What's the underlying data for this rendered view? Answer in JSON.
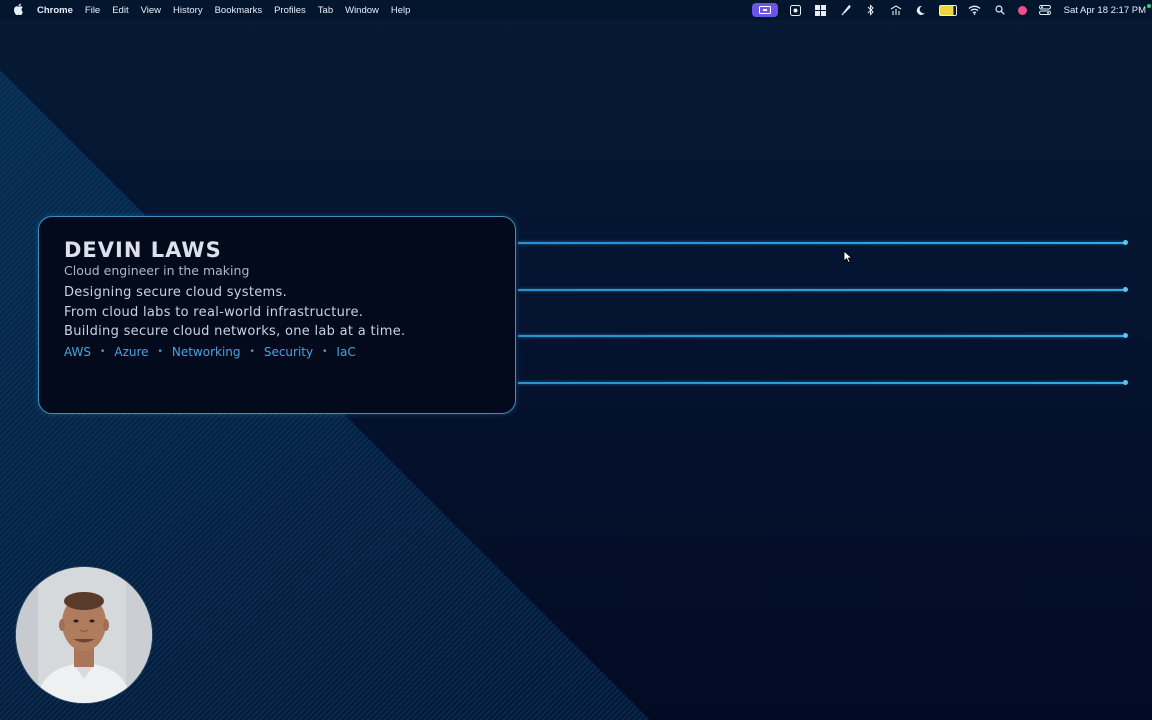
{
  "menubar": {
    "app_name": "Chrome",
    "menus": [
      "File",
      "Edit",
      "View",
      "History",
      "Bookmarks",
      "Profiles",
      "Tab",
      "Window",
      "Help"
    ],
    "clock": "Sat Apr 18  2:17 PM"
  },
  "status_icons": [
    "screen-share-icon",
    "screenshot-icon",
    "grid-icon",
    "feather-icon",
    "bluetooth-icon",
    "network-icon",
    "moon-icon",
    "battery-icon",
    "wifi-icon",
    "search-icon",
    "record-icon",
    "control-center-icon"
  ],
  "card": {
    "name": "DEVIN LAWS",
    "subtitle": "Cloud engineer in the making",
    "lines": [
      "Designing secure cloud systems.",
      "From cloud labs to real-world infrastructure.",
      "Building secure cloud networks, one lab at a time."
    ],
    "tags": [
      "AWS",
      "Azure",
      "Networking",
      "Security",
      "IaC"
    ],
    "tag_separator": "•"
  },
  "colors": {
    "background": "#041330",
    "accent": "#35a8e6",
    "card_border": "#3f8ec2",
    "tag_text": "#4aa3de",
    "active_status": "#6a55e8"
  }
}
